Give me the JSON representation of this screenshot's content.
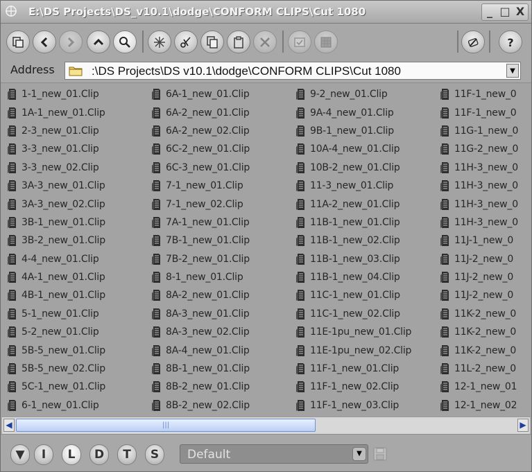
{
  "window": {
    "title": "E:\\DS Projects\\DS_v10.1\\dodge\\CONFORM CLIPS\\Cut 1080",
    "controls": [
      "_",
      "□",
      "X"
    ]
  },
  "toolbar": {
    "buttons": [
      "views-icon",
      "back-icon",
      "forward-icon",
      "up-icon",
      "find-icon",
      "new-icon",
      "cut-icon",
      "copy-icon",
      "paste-icon",
      "delete-icon",
      "check-icon",
      "grid-icon",
      "edit-icon",
      "help-icon"
    ]
  },
  "address": {
    "label": "Address",
    "path": ":\\DS Projects\\DS  v10.1\\dodge\\CONFORM CLIPS\\Cut 1080"
  },
  "files": {
    "col1": [
      "1-1_new_01.Clip",
      "1A-1_new_01.Clip",
      "2-3_new_01.Clip",
      "3-3_new_01.Clip",
      "3-3_new_02.Clip",
      "3A-3_new_01.Clip",
      "3A-3_new_02.Clip",
      "3B-1_new_01.Clip",
      "3B-2_new_01.Clip",
      "4-4_new_01.Clip",
      "4A-1_new_01.Clip",
      "4B-1_new_01.Clip",
      "5-1_new_01.Clip",
      "5-2_new_01.Clip",
      "5B-5_new_01.Clip",
      "5B-5_new_02.Clip",
      "5C-1_new_01.Clip",
      "6-1_new_01.Clip"
    ],
    "col2": [
      "6A-1_new_01.Clip",
      "6A-2_new_01.Clip",
      "6A-2_new_02.Clip",
      "6C-2_new_01.Clip",
      "6C-3_new_01.Clip",
      "7-1_new_01.Clip",
      "7-1_new_02.Clip",
      "7A-1_new_01.Clip",
      "7B-1_new_01.Clip",
      "7B-2_new_01.Clip",
      "8-1_new_01.Clip",
      "8A-2_new_01.Clip",
      "8A-3_new_01.Clip",
      "8A-3_new_02.Clip",
      "8A-4_new_01.Clip",
      "8B-1_new_01.Clip",
      "8B-2_new_01.Clip",
      "8B-2_new_02.Clip"
    ],
    "col3": [
      "9-2_new_01.Clip",
      "9A-4_new_01.Clip",
      "9B-1_new_01.Clip",
      "10A-4_new_01.Clip",
      "10B-2_new_01.Clip",
      "11-3_new_01.Clip",
      "11A-2_new_01.Clip",
      "11B-1_new_01.Clip",
      "11B-1_new_02.Clip",
      "11B-1_new_03.Clip",
      "11B-1_new_04.Clip",
      "11C-1_new_01.Clip",
      "11C-1_new_02.Clip",
      "11E-1pu_new_01.Clip",
      "11E-1pu_new_02.Clip",
      "11F-1_new_01.Clip",
      "11F-1_new_02.Clip",
      "11F-1_new_03.Clip"
    ],
    "col4": [
      "11F-1_new_0",
      "11F-1_new_0",
      "11G-1_new_0",
      "11G-2_new_0",
      "11H-3_new_0",
      "11H-3_new_0",
      "11H-3_new_0",
      "11H-3_new_0",
      "11J-1_new_0",
      "11J-2_new_0",
      "11J-2_new_0",
      "11J-2_new_0",
      "11K-2_new_0",
      "11K-2_new_0",
      "11K-2_new_0",
      "11L-2_new_0",
      "12-1_new_01",
      "12-1_new_02"
    ]
  },
  "bottom": {
    "view_buttons": [
      "▼",
      "I",
      "L",
      "D",
      "T",
      "S"
    ],
    "active_view": "L",
    "preset": "Default"
  }
}
